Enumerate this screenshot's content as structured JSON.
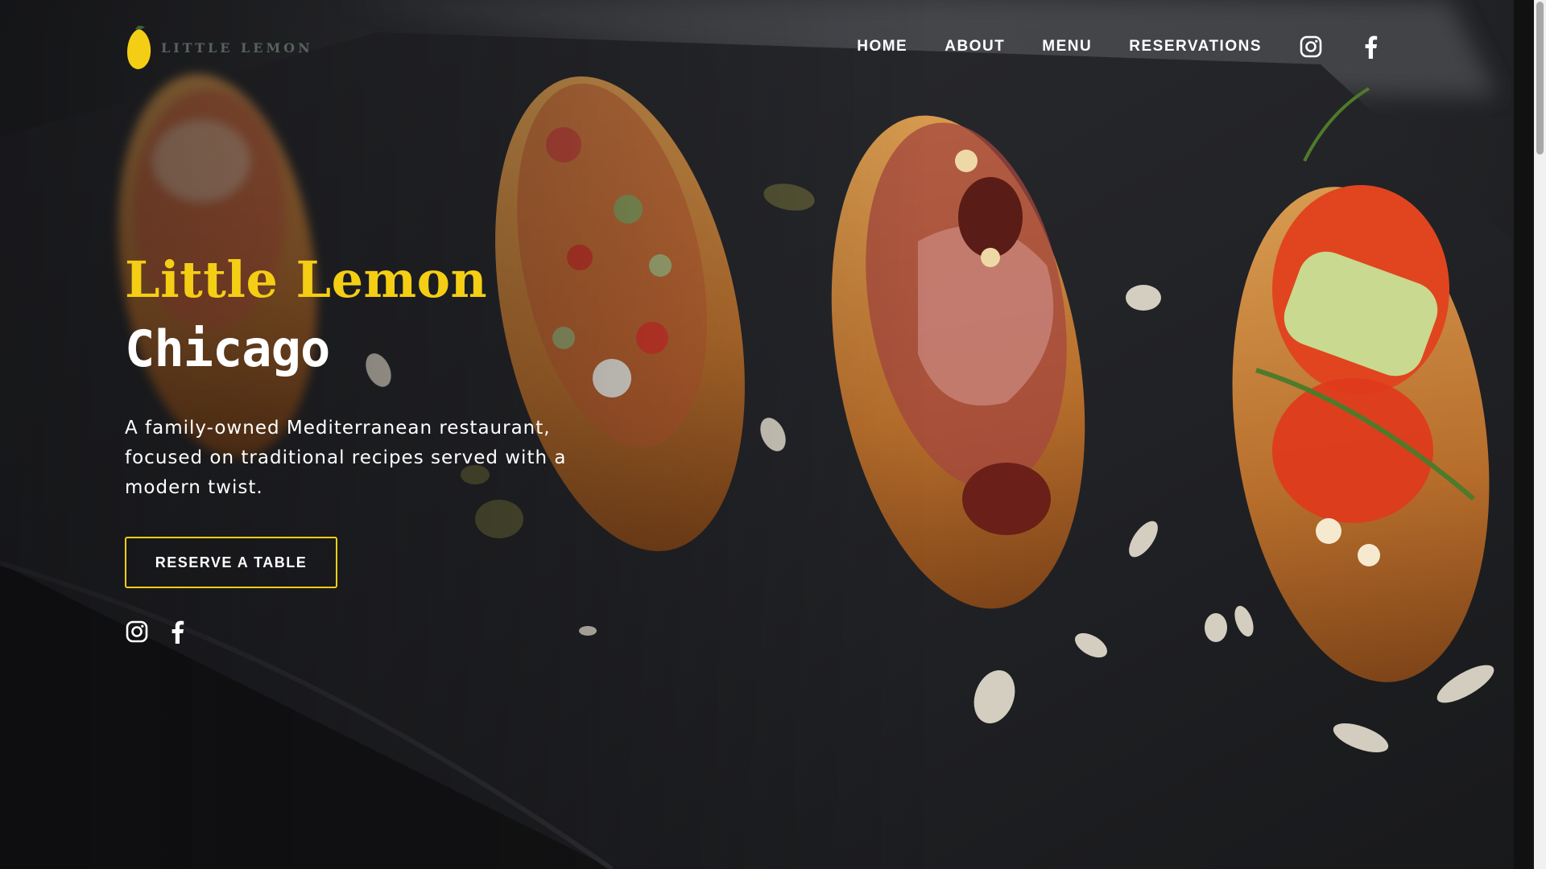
{
  "brand": {
    "logo_text": "LITTLE LEMON",
    "accent_color": "#f4ce14",
    "logo_icon": "lemon-icon"
  },
  "nav": {
    "links": [
      {
        "label": "HOME"
      },
      {
        "label": "ABOUT"
      },
      {
        "label": "MENU"
      },
      {
        "label": "RESERVATIONS"
      }
    ],
    "icons": [
      "instagram-icon",
      "facebook-icon"
    ]
  },
  "hero": {
    "title": "Little Lemon",
    "subtitle": "Chicago",
    "description": "A family-owned Mediterranean restaurant, focused on traditional recipes served with a modern twist.",
    "cta_label": "RESERVE A TABLE",
    "social_icons": [
      "instagram-icon",
      "facebook-icon"
    ]
  }
}
